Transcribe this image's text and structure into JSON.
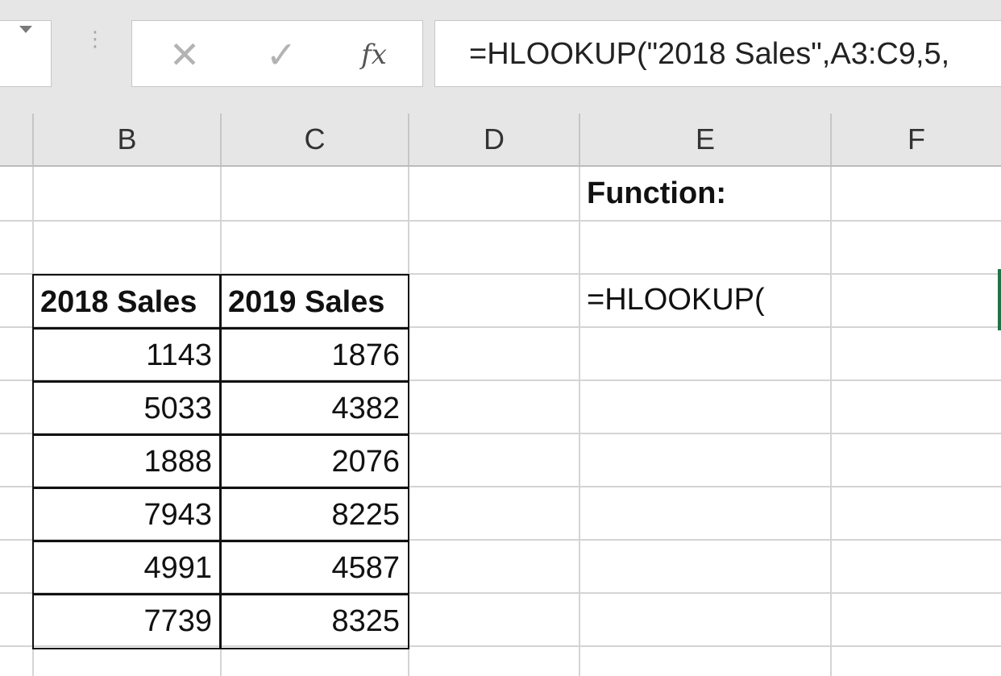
{
  "formula_bar": {
    "fx_label": "fx",
    "formula": "=HLOOKUP(\"2018 Sales\",A3:C9,5,"
  },
  "columns": [
    "B",
    "C",
    "D",
    "E",
    "F"
  ],
  "cells": {
    "E1": "Function:",
    "E3": "=HLOOKUP(",
    "B3": "2018 Sales",
    "C3": "2019 Sales"
  },
  "table": {
    "rows": [
      [
        "1143",
        "1876"
      ],
      [
        "5033",
        "4382"
      ],
      [
        "1888",
        "2076"
      ],
      [
        "7943",
        "8225"
      ],
      [
        "4991",
        "4587"
      ],
      [
        "7739",
        "8325"
      ]
    ]
  },
  "icons": {
    "namebox": "chevron-down-icon",
    "cancel": "close-icon",
    "enter": "check-icon",
    "function": "fx-icon"
  },
  "colors": {
    "selection": "#217346",
    "chrome": "#e6e6e6"
  }
}
